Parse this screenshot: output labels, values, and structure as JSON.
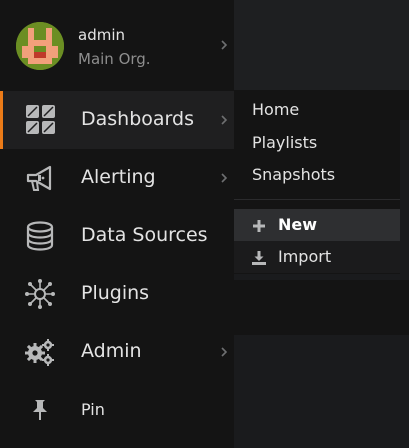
{
  "profile": {
    "name": "admin",
    "org": "Main Org."
  },
  "nav": {
    "dashboards": "Dashboards",
    "alerting": "Alerting",
    "data_sources": "Data Sources",
    "plugins": "Plugins",
    "admin": "Admin",
    "pin": "Pin"
  },
  "flyout": {
    "home": "Home",
    "playlists": "Playlists",
    "snapshots": "Snapshots",
    "new": "New",
    "import": "Import"
  },
  "colors": {
    "accent": "#eb7b18",
    "sidebar_bg": "#141414",
    "text": "#e3e3e3",
    "muted": "#8e8e8e",
    "icon": "#b7b8b9"
  },
  "icons": {
    "avatar": "avatar-icon",
    "dashboards": "grid-squares-icon",
    "alerting": "megaphone-icon",
    "data_sources": "database-icon",
    "plugins": "plugin-network-icon",
    "admin": "gears-icon",
    "pin": "pin-icon",
    "new": "plus-icon",
    "import": "download-icon"
  }
}
